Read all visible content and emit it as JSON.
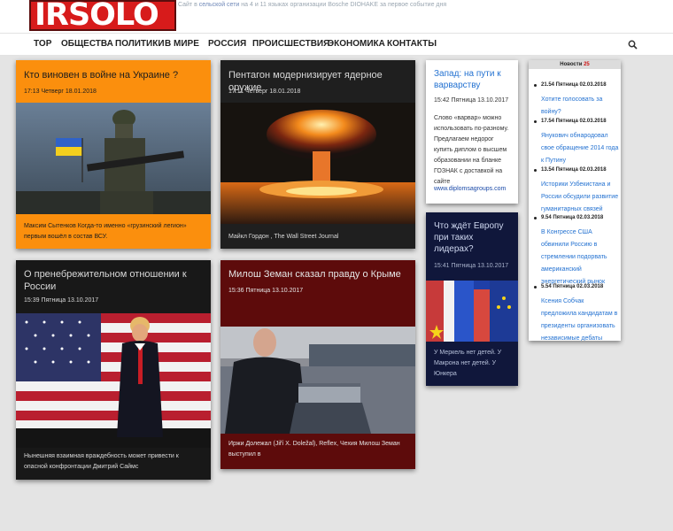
{
  "site": {
    "logo": "IRSOLO",
    "tagline_parts": [
      "Сайт в ",
      "сельской сети",
      " на 4 и 11 языках организации Bosche DIOHAKE за первое событие дня"
    ]
  },
  "nav": [
    "TOP",
    "ОБЩЕСТВА",
    "ПОЛИТИКИ",
    "В МИРЕ",
    "РОССИЯ",
    "ПРОИСШЕСТВИЯ",
    "ЭКОНОМИКА",
    "КОНТАКТЫ"
  ],
  "icons": {
    "search": "search-icon"
  },
  "cards": [
    {
      "title": "Кто виновен в войне на Украине ?",
      "date": "17:13 Четверг 18.01.2018",
      "caption": "Максим Сытенков Когда-то именно «грузинский легион» первым вошёл в состав ВСУ.",
      "image": "soldier-with-ukrainian-flag"
    },
    {
      "title": "Пентагон модернизирует ядерное оружие",
      "date": "17:11 Четверг 18.01.2018",
      "caption": "Майкл Гордон , The Wall Street Journal",
      "image": "nuclear-explosion"
    },
    {
      "title": "О пренебрежительном отношении к России",
      "date": "15:39 Пятница 13.10.2017",
      "caption": "Нынешняя взаимная враждебность может привести к опасной конфронтации Дмитрий Саймс",
      "image": "politician-before-us-flag"
    },
    {
      "title": "Милош Земан сказал правду о Крыме",
      "date": "15:36 Пятница 13.10.2017",
      "caption": "Иржи Долежал (Jiří X. Doležal), Reflex, Чехия Милош Земан выступил в",
      "image": "speaker-at-podium"
    },
    {
      "title": "Запад: на пути к варварству",
      "date": "15:42 Пятница 13.10.2017",
      "caption": "Слово «варвар» можно использовать по-разному. Предлагаем недорог купить диплом о высшем образовании на бланке ГОЗНАК с доставкой на сайте",
      "link": "www.diplomsagroups.com"
    },
    {
      "title": "Что ждёт Европу при таких лидерах?",
      "date": "15:41 Пятница 13.10.2017",
      "caption": "У Меркель нет детей. У Макрона нет детей. У Юнкера",
      "image": "european-union-flags"
    }
  ],
  "news": {
    "heading": "Новости",
    "count": "25",
    "items": [
      {
        "date": "21.54 Пятница 02.03.2018",
        "title": "Хотите голосовать за войну?"
      },
      {
        "date": "17.54 Пятница 02.03.2018",
        "title": "Янукович обнародовал свое обращение 2014 года к Путину"
      },
      {
        "date": "13.54 Пятница 02.03.2018",
        "title": "Историки Узбекистана и России обсудили развитие гуманитарных связей"
      },
      {
        "date": "9.54 Пятница 02.03.2018",
        "title": "В Конгрессе США обвинили Россию в стремлении подорвать американский энергетический рынок"
      },
      {
        "date": "5.54 Пятница 02.03.2018",
        "title": "Ксения Собчак предложила кандидатам в президенты организовать независимые дебаты"
      }
    ]
  }
}
